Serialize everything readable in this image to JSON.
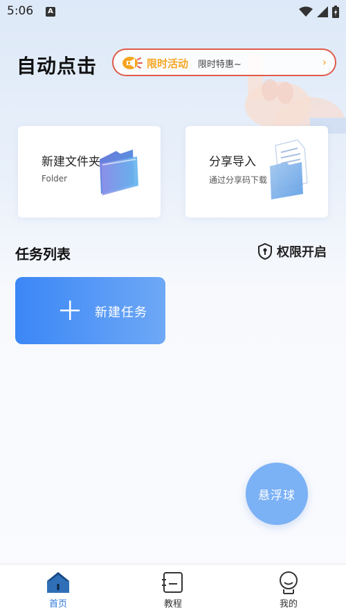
{
  "status_bar": {
    "time": "5:06",
    "notification_icon": "font-a-icon",
    "icons": [
      "wifi-icon",
      "cellular-signal-icon",
      "battery-charging-icon"
    ]
  },
  "header": {
    "title": "自动点击",
    "promo": {
      "title": "限时活动",
      "subtitle": "限时特惠~",
      "accent_color": "#f5a623",
      "border_color": "#e05a4a"
    }
  },
  "cards": [
    {
      "title": "新建文件夹",
      "subtitle": "Folder"
    },
    {
      "title": "分享导入",
      "subtitle": "通过分享码下载"
    }
  ],
  "tasks": {
    "section_title": "任务列表",
    "permission_label": "权限开启",
    "new_task_label": "新建任务",
    "button_gradient": [
      "#3b87f6",
      "#6ea8f6"
    ]
  },
  "floating_ball": {
    "label": "悬浮球",
    "color": "#7bb1f5"
  },
  "bottom_nav": {
    "items": [
      {
        "label": "首页",
        "icon": "home-icon",
        "active": true
      },
      {
        "label": "教程",
        "icon": "tutorial-icon",
        "active": false
      },
      {
        "label": "我的",
        "icon": "profile-icon",
        "active": false
      }
    ],
    "active_color": "#2f78d8"
  }
}
